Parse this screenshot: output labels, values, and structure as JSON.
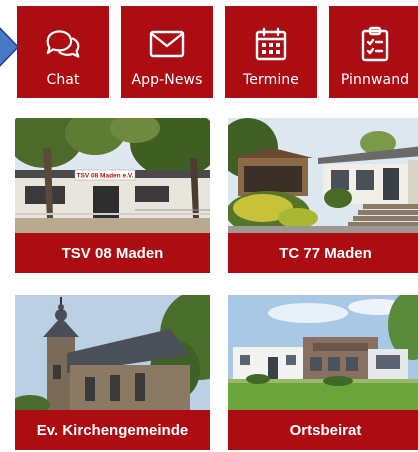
{
  "nav": {
    "items": [
      {
        "label": "Chat",
        "icon": "chat-bubbles-icon"
      },
      {
        "label": "App-News",
        "icon": "envelope-icon"
      },
      {
        "label": "Termine",
        "icon": "calendar-icon"
      },
      {
        "label": "Pinnwand",
        "icon": "clipboard-icon"
      }
    ]
  },
  "cards": [
    {
      "title": "TSV 08 Maden",
      "sign": "TSV 08 Maden e.V."
    },
    {
      "title": "TC 77 Maden"
    },
    {
      "title": "Ev. Kirchengemeinde"
    },
    {
      "title": "Ortsbeirat"
    }
  ],
  "colors": {
    "accent": "#ab0d13",
    "pointer": "#4a78c8"
  }
}
